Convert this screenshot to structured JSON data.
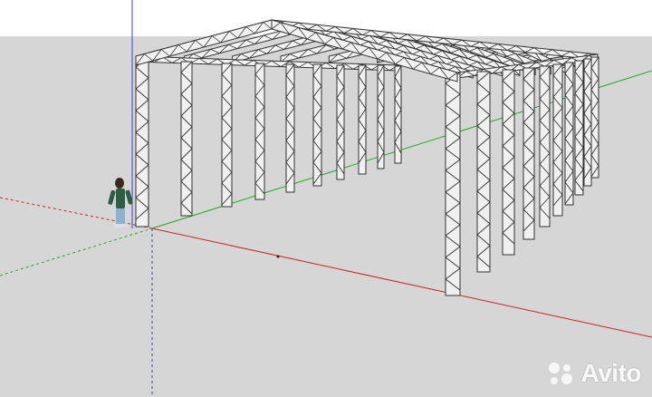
{
  "viewport": {
    "sky_color": "#ffffff",
    "ground_color": "#d6d6d6",
    "axis_colors": {
      "red": "#cc2222",
      "green": "#22aa22",
      "blue": "#3344cc"
    }
  },
  "model": {
    "description_icon": "truss-frame-structure",
    "truss_count_left": 9,
    "truss_count_right": 10
  },
  "figure": {
    "icon": "scale-person-figure"
  },
  "watermark": {
    "text": "Avito",
    "icon": "avito-logo-icon"
  }
}
